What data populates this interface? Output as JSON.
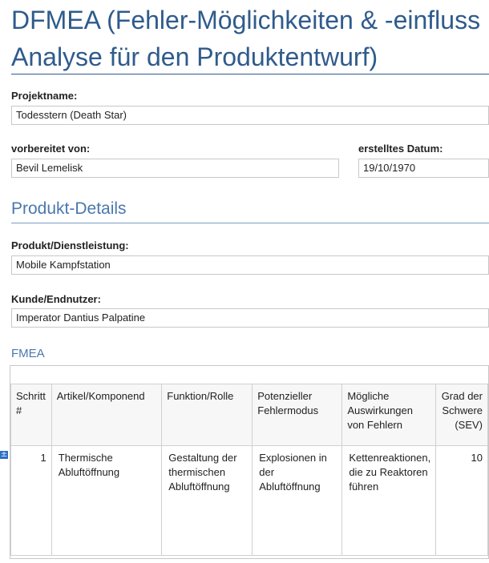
{
  "page": {
    "title": "DFMEA (Fehler-Möglichkeiten & -einfluss Analyse für den Produktentwurf)"
  },
  "project": {
    "name_label": "Projektname:",
    "name_value": "Todesstern (Death Star)",
    "prepared_by_label": "vorbereitet von:",
    "prepared_by_value": "Bevil Lemelisk",
    "date_label": "erstelltes Datum:",
    "date_value": "19/10/1970"
  },
  "product": {
    "heading": "Produkt-Details",
    "product_label": "Produkt/Dienstleistung:",
    "product_value": "Mobile Kampfstation",
    "customer_label": "Kunde/Endnutzer:",
    "customer_value": "Imperator Dantius Palpatine"
  },
  "fmea": {
    "heading": "FMEA",
    "add_row_icon": "plus-icon",
    "columns": [
      "Schritt #",
      "Artikel/Komponend",
      "Funktion/Rolle",
      "Potenzieller Fehlermodus",
      "Mögliche Auswirkungen von Fehlern",
      "Grad der Schwere (SEV)"
    ],
    "rows": [
      {
        "step": "1",
        "item": "Thermische Abluftöffnung",
        "function": "Gestaltung der thermischen Abluftöffnung",
        "failure_mode": "Explosionen in der Abluftöffnung",
        "effects": "Kettenreaktionen, die zu Reaktoren führen",
        "severity": "10"
      }
    ]
  }
}
